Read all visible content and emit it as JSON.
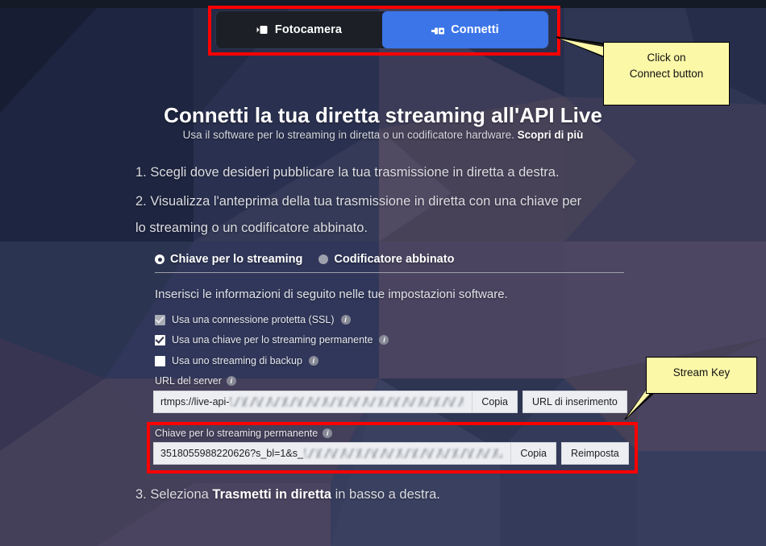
{
  "tabs": [
    {
      "label": "Fotocamera",
      "icon": "video-camera-icon",
      "active": false
    },
    {
      "label": "Connetti",
      "icon": "plug-connector-icon",
      "active": true
    }
  ],
  "heading": "Connetti la tua diretta streaming all'API Live",
  "subheading": {
    "text": "Usa il software per lo streaming in diretta o un codificatore hardware.",
    "link": "Scopri di più"
  },
  "steps": {
    "step1": "1. Scegli dove desideri pubblicare la tua trasmissione in diretta a destra.",
    "step2": "2. Visualizza l'anteprima della tua trasmissione in diretta con una chiave per",
    "step2_cont": "lo streaming o un codificatore abbinato.",
    "step3_pre": "3. Seleziona ",
    "step3_bold": "Trasmetti in diretta",
    "step3_post": " in basso a destra."
  },
  "mode_options": [
    {
      "label": "Chiave per lo streaming",
      "selected": true
    },
    {
      "label": "Codificatore abbinato",
      "selected": false
    }
  ],
  "instruction": "Inserisci le informazioni di seguito nelle tue impostazioni software.",
  "checkboxes": [
    {
      "label": "Usa una connessione protetta (SSL)",
      "state": "disabled-checked"
    },
    {
      "label": "Usa una chiave per lo streaming permanente",
      "state": "checked"
    },
    {
      "label": "Usa uno streaming di backup",
      "state": "unchecked"
    }
  ],
  "server_url_field": {
    "label": "URL del server",
    "value": "rtmps://live-api-",
    "redacted": true,
    "copy_button": "Copia",
    "paste_button": "URL di inserimento"
  },
  "stream_key_field": {
    "label": "Chiave per lo streaming permanente",
    "value": "3518055988220626?s_bl=1&s_",
    "redacted": true,
    "copy_button": "Copia",
    "reset_button": "Reimposta"
  },
  "callouts": [
    {
      "name": "connect-callout",
      "line1": "Click on",
      "line2": "Connect button"
    },
    {
      "name": "stream-key-callout",
      "line1": "Stream Key",
      "line2": ""
    }
  ],
  "colors": {
    "accent_blue": "#3b75e8",
    "highlight_red": "#fe0000",
    "callout_yellow": "#fbf8a8",
    "bg_navy": "#2b3556",
    "bg_purple": "#4a4258"
  },
  "info_icon_glyph": "i"
}
